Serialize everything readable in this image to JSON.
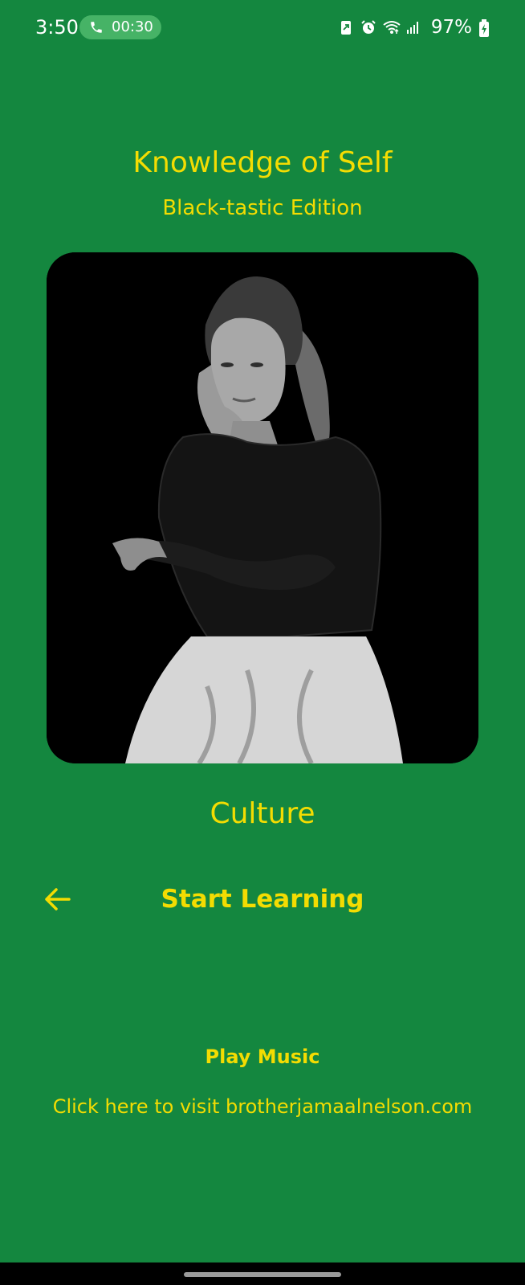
{
  "status_bar": {
    "time": "3:50",
    "call_timer": "00:30",
    "battery_percent": "97%",
    "icons": [
      "phone-icon",
      "battery-saver-icon",
      "alarm-icon",
      "wifi-icon",
      "signal-icon",
      "battery-charging-icon"
    ]
  },
  "header": {
    "title": "Knowledge of Self",
    "subtitle": "Black-tastic Edition"
  },
  "card": {
    "image_description_icon": "portrait-photo"
  },
  "category": {
    "label": "Culture"
  },
  "actions": {
    "back_icon": "arrow-left-icon",
    "start_learning_label": "Start Learning",
    "play_music_label": "Play Music",
    "visit_link_label": "Click here to visit brotherjamaalnelson.com"
  },
  "colors": {
    "background": "#14873f",
    "accent_text": "#f3dc02",
    "call_pill": "#46b366"
  }
}
